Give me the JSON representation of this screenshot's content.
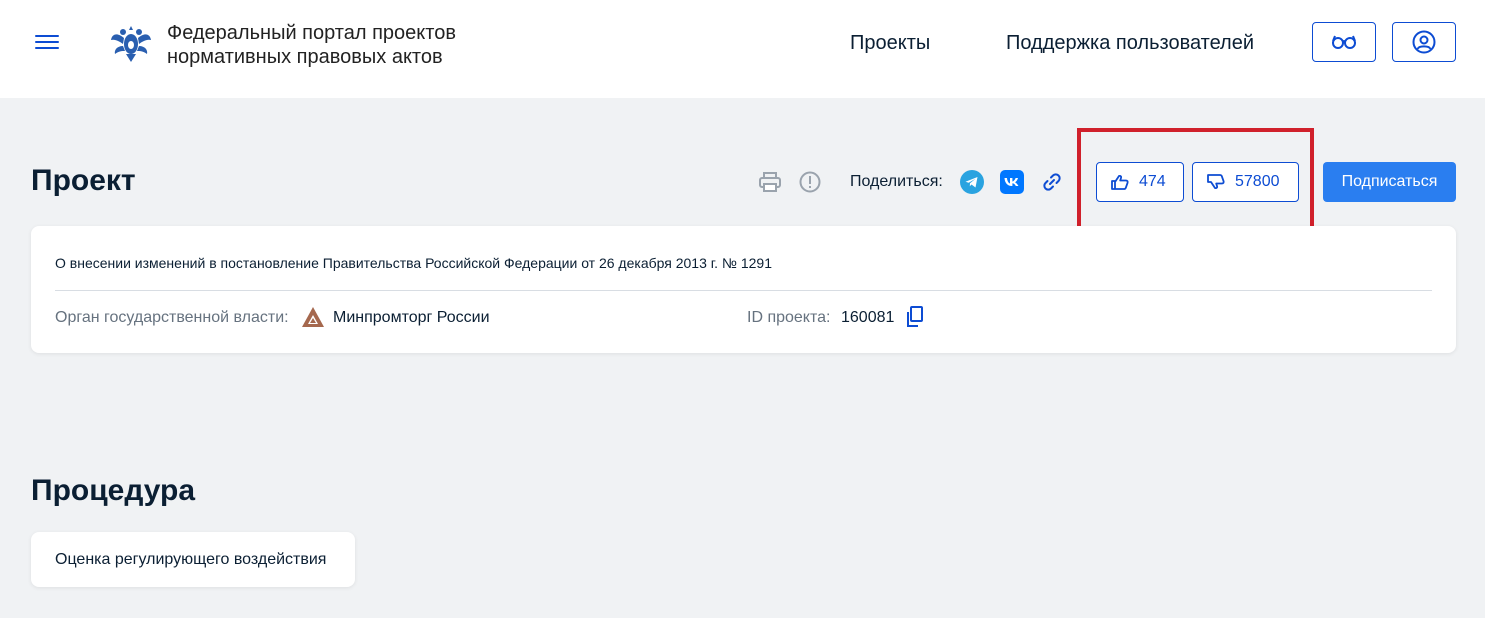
{
  "header": {
    "portal_title_line1": "Федеральный портал проектов",
    "portal_title_line2": "нормативных правовых актов",
    "nav": [
      "Проекты",
      "Поддержка пользователей"
    ],
    "icons": [
      "menu-icon",
      "emblem-icon",
      "glasses-icon",
      "user-icon"
    ]
  },
  "project": {
    "heading": "Проект",
    "share_label": "Поделиться:",
    "share_icons": [
      "telegram-icon",
      "vk-icon",
      "link-icon"
    ],
    "tool_icons": [
      "print-icon",
      "warning-icon"
    ],
    "likes": "474",
    "dislikes": "57800",
    "subscribe_label": "Подписаться",
    "title": "О внесении изменений в постановление Правительства Российской Федерации от 26 декабря 2013 г. № 1291",
    "authority_label": "Орган государственной власти:",
    "authority_value": "Минпромторг России",
    "id_label": "ID проекта:",
    "id_value": "160081"
  },
  "procedure": {
    "heading": "Процедура",
    "stage": "Оценка регулирующего воздействия"
  },
  "colors": {
    "accent": "#0d4cd3",
    "button": "#2a7ef0",
    "highlight": "#d0202b",
    "background": "#f0f2f4"
  }
}
